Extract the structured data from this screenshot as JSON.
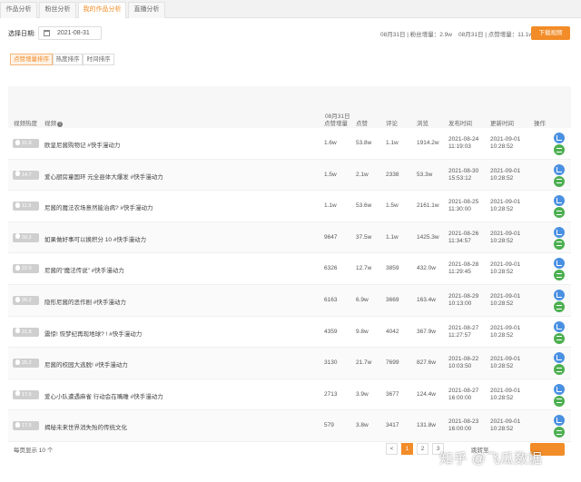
{
  "tabs": [
    {
      "label": "作品分析",
      "active": false
    },
    {
      "label": "粉丝分析",
      "active": false
    },
    {
      "label": "我的作品分析",
      "active": true
    },
    {
      "label": "直播分析",
      "active": false
    }
  ],
  "filter": {
    "date_label": "选择日期:",
    "date_value": "2021-08-31",
    "fans_stat": "08月31日 | 粉丝增量：2.9w",
    "likes_stat": "08月31日 | 点赞增量：11.1w",
    "download_label": "下载视频"
  },
  "sort_buttons": [
    {
      "label": "点赞增量排序",
      "active": true
    },
    {
      "label": "热度排序",
      "active": false
    },
    {
      "label": "时间排序",
      "active": false
    }
  ],
  "table": {
    "headers": {
      "heat": "视频热度",
      "video": "视频",
      "like_inc_date": "08月31日",
      "like_inc": "点赞增量",
      "likes": "点赞",
      "comments": "评论",
      "plays": "浏览",
      "publish": "发布时间",
      "update": "更新时间",
      "ops": "操作"
    },
    "rows": [
      {
        "heat": "31.8",
        "title": "欧皇尼酱购物记 #快手漫动力",
        "like_inc": "1.6w",
        "likes": "53.8w",
        "comments": "1.1w",
        "plays": "1914.2w",
        "pub_date": "2021-08-24",
        "pub_time": "11:19:03",
        "upd_date": "2021-09-01",
        "upd_time": "10:28:52"
      },
      {
        "heat": "14.7",
        "title": "爱心厨房童国环 元全县体大爆发 #快手漫动力",
        "like_inc": "1.5w",
        "likes": "2.1w",
        "comments": "2338",
        "plays": "53.3w",
        "pub_date": "2021-08-30",
        "pub_time": "15:53:12",
        "upd_date": "2021-09-01",
        "upd_time": "10:28:52"
      },
      {
        "heat": "11.9",
        "title": "尼酱的魔法农场意然能治病? #快手漫动力",
        "like_inc": "1.1w",
        "likes": "53.6w",
        "comments": "1.5w",
        "plays": "2161.1w",
        "pub_date": "2021-08-25",
        "pub_time": "11:30:00",
        "upd_date": "2021-09-01",
        "upd_time": "10:28:52"
      },
      {
        "heat": "30.2",
        "title": "如果做好事可以换积分 10 #快手漫动力",
        "like_inc": "9647",
        "likes": "37.5w",
        "comments": "1.1w",
        "plays": "1425.3w",
        "pub_date": "2021-08-26",
        "pub_time": "11:34:57",
        "upd_date": "2021-09-01",
        "upd_time": "10:28:52"
      },
      {
        "heat": "22.9",
        "title": "尼酱的“魔法传说” #快手漫动力",
        "like_inc": "6326",
        "likes": "12.7w",
        "comments": "3859",
        "plays": "432.0w",
        "pub_date": "2021-08-28",
        "pub_time": "11:29:45",
        "upd_date": "2021-09-01",
        "upd_time": "10:28:52"
      },
      {
        "heat": "26.2",
        "title": "隐形尼酱的恶作剧 #快手漫动力",
        "like_inc": "6163",
        "likes": "6.9w",
        "comments": "3669",
        "plays": "163.4w",
        "pub_date": "2021-08-29",
        "pub_time": "10:13:00",
        "upd_date": "2021-09-01",
        "upd_time": "10:28:52"
      },
      {
        "heat": "21.8",
        "title": "震惊! 恢梦纪再现地球? ! #快手漫动力",
        "like_inc": "4359",
        "likes": "9.8w",
        "comments": "4042",
        "plays": "367.9w",
        "pub_date": "2021-08-27",
        "pub_time": "11:27:57",
        "upd_date": "2021-09-01",
        "upd_time": "10:28:52"
      },
      {
        "heat": "25.2",
        "title": "尼酱的校园大逃脱! #快手漫动力",
        "like_inc": "3130",
        "likes": "21.7w",
        "comments": "7699",
        "plays": "827.6w",
        "pub_date": "2021-08-22",
        "pub_time": "10:03:50",
        "upd_date": "2021-09-01",
        "upd_time": "10:28:52"
      },
      {
        "heat": "17.6",
        "title": "爱心小队遭遇麻雀 行动会在嘴雕 #快手漫动力",
        "like_inc": "2713",
        "likes": "3.9w",
        "comments": "3677",
        "plays": "124.4w",
        "pub_date": "2021-08-27",
        "pub_time": "16:00:00",
        "upd_date": "2021-09-01",
        "upd_time": "10:28:52"
      },
      {
        "heat": "17.5",
        "title": "揭秘未来世界消失殆的传统文化",
        "like_inc": "579",
        "likes": "3.8w",
        "comments": "3417",
        "plays": "131.8w",
        "pub_date": "2021-08-23",
        "pub_time": "16:00:00",
        "upd_date": "2021-09-01",
        "upd_time": "10:28:52"
      }
    ]
  },
  "pagination": {
    "per_page": "每页显示 10 个",
    "pages": [
      "<",
      "1",
      "2",
      "3"
    ],
    "goto_label": "跳转至",
    "active_page": "1"
  },
  "watermark": "知乎 @飞瓜数据",
  "colors": {
    "accent": "#f28c28",
    "op_blue": "#4a90e2",
    "op_green": "#4caf50"
  }
}
